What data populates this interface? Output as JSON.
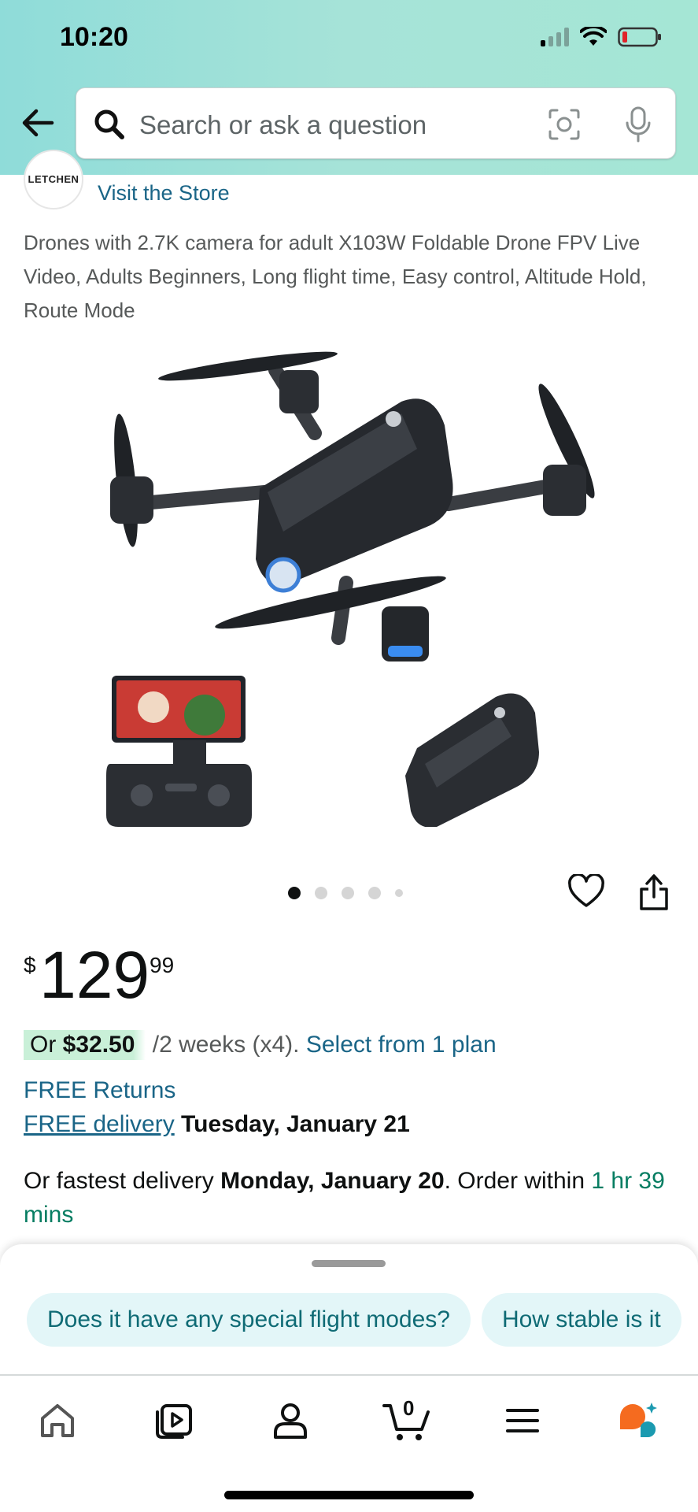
{
  "status_bar": {
    "time": "10:20"
  },
  "search": {
    "placeholder": "Search or ask a question"
  },
  "store": {
    "logo_text": "LETCHEN",
    "visit_label": "Visit the Store"
  },
  "product": {
    "title": "Drones with 2.7K camera for adult X103W Foldable Drone FPV Live Video, Adults Beginners, Long flight time, Easy control, Altitude Hold, Route Mode",
    "image_count": 5,
    "active_image_index": 0
  },
  "price": {
    "symbol": "$",
    "whole": "129",
    "fraction": "99"
  },
  "installment": {
    "prefix": "Or ",
    "amount": "$32.50",
    "suffix": " /2 weeks (x4). ",
    "plan_link": "Select from 1 plan"
  },
  "returns": {
    "label": "FREE Returns"
  },
  "delivery": {
    "link": "FREE delivery",
    "date": " Tuesday, January 21"
  },
  "fastest": {
    "prefix": "Or fastest delivery ",
    "date": "Monday, January 20",
    "middle": ". Order within ",
    "countdown": "1 hr 39 mins"
  },
  "questions": [
    "Does it have any special flight modes?",
    "How stable is it"
  ],
  "cart": {
    "count": "0"
  },
  "colors": {
    "link": "#1a6587",
    "green": "#067d62",
    "chip_bg": "#e3f6f8",
    "chip_text": "#0f6b75"
  }
}
